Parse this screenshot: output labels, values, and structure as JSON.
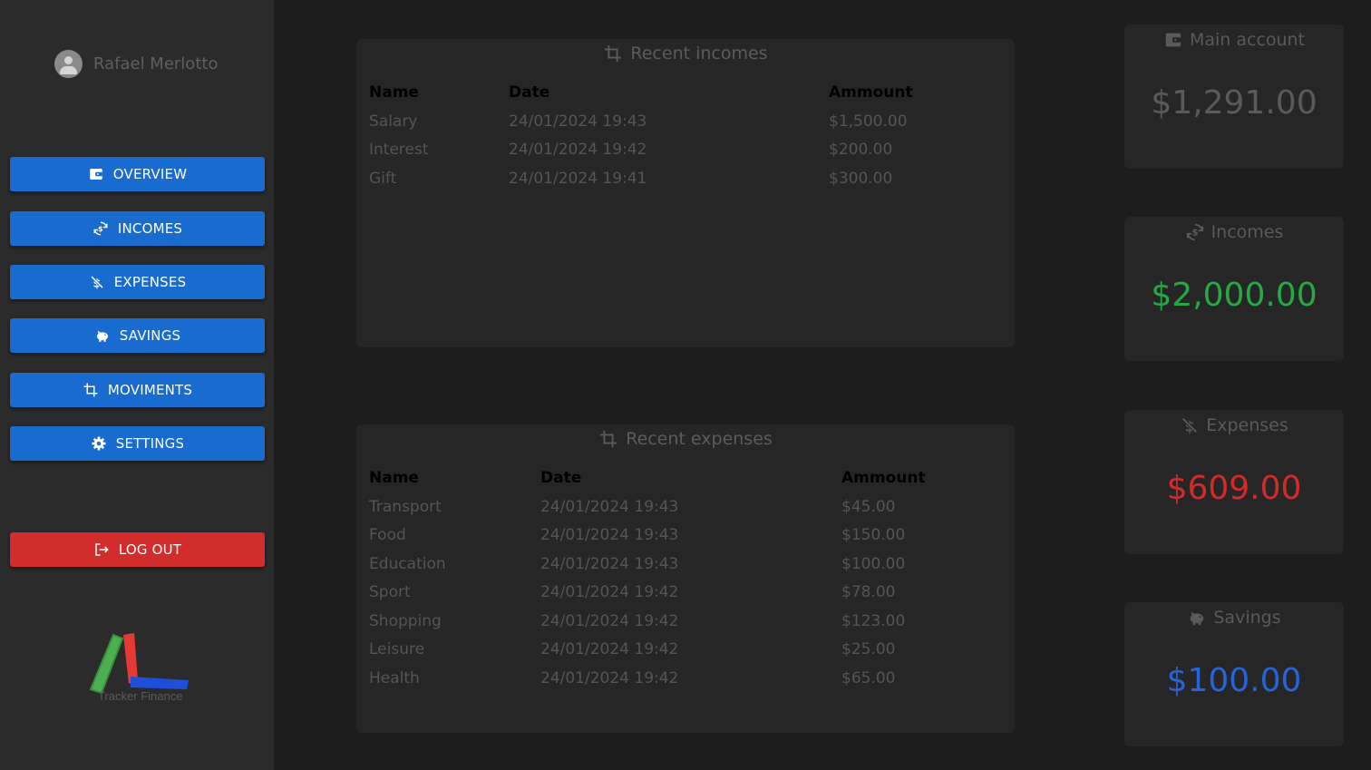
{
  "user": {
    "name": "Rafael Merlotto"
  },
  "nav": {
    "overview": "OVERVIEW",
    "incomes": "INCOMES",
    "expenses": "EXPENSES",
    "savings": "SAVINGS",
    "moviments": "MOVIMENTS",
    "settings": "SETTINGS",
    "logout": "LOG OUT"
  },
  "logo": {
    "text": "Tracker Finance"
  },
  "recent_incomes": {
    "title": "Recent incomes",
    "columns": [
      "Name",
      "Date",
      "Ammount"
    ],
    "rows": [
      [
        "Salary",
        "24/01/2024 19:43",
        "$1,500.00"
      ],
      [
        "Interest",
        "24/01/2024 19:42",
        "$200.00"
      ],
      [
        "Gift",
        "24/01/2024 19:41",
        "$300.00"
      ]
    ]
  },
  "recent_expenses": {
    "title": "Recent expenses",
    "columns": [
      "Name",
      "Date",
      "Ammount"
    ],
    "rows": [
      [
        "Transport",
        "24/01/2024 19:43",
        "$45.00"
      ],
      [
        "Food",
        "24/01/2024 19:43",
        "$150.00"
      ],
      [
        "Education",
        "24/01/2024 19:43",
        "$100.00"
      ],
      [
        "Sport",
        "24/01/2024 19:42",
        "$78.00"
      ],
      [
        "Shopping",
        "24/01/2024 19:42",
        "$123.00"
      ],
      [
        "Leisure",
        "24/01/2024 19:42",
        "$25.00"
      ],
      [
        "Health",
        "24/01/2024 19:42",
        "$65.00"
      ]
    ]
  },
  "summary": {
    "main_account": {
      "label": "Main account",
      "value": "$1,291.00",
      "color": "#5a5a5a"
    },
    "incomes": {
      "label": "Incomes",
      "value": "$2,000.00",
      "color": "#26a844"
    },
    "expenses": {
      "label": "Expenses",
      "value": "$609.00",
      "color": "#d42a2a"
    },
    "savings": {
      "label": "Savings",
      "value": "$100.00",
      "color": "#2563d9"
    }
  },
  "colors": {
    "primary": "#1a6bd0",
    "danger": "#d12d2d",
    "background": "#1d1d1d",
    "sidebar": "#2b2b2b",
    "card": "#262626"
  }
}
